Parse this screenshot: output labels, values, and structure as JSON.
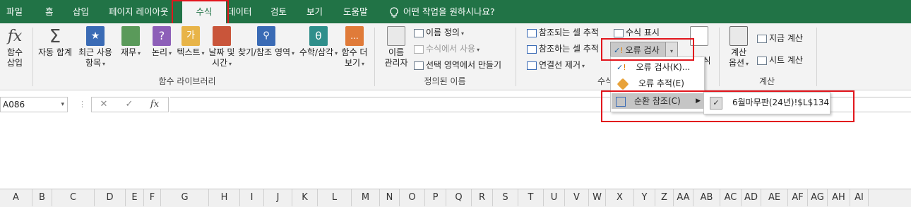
{
  "tabs": [
    {
      "label": "파일"
    },
    {
      "label": "홈"
    },
    {
      "label": "삽입"
    },
    {
      "label": "페이지 레이아웃"
    },
    {
      "label": "수식"
    },
    {
      "label": "데이터"
    },
    {
      "label": "검토"
    },
    {
      "label": "보기"
    },
    {
      "label": "도움말"
    }
  ],
  "tell_me": "어떤 작업을 원하시나요?",
  "function_library": {
    "group_label": "함수 라이브러리",
    "insert_function": {
      "line1": "함수",
      "line2": "삽입",
      "icon": "fx"
    },
    "autosum": {
      "line1": "자동 합계",
      "icon": "Σ"
    },
    "recent": {
      "line1": "최근 사용",
      "line2": "항목"
    },
    "financial": {
      "line1": "재무"
    },
    "logical": {
      "line1": "논리",
      "icon": "?"
    },
    "text": {
      "line1": "텍스트",
      "icon": "가"
    },
    "date_time": {
      "line1": "날짜 및",
      "line2": "시간"
    },
    "lookup": {
      "line1": "찾기/참조 영역"
    },
    "math": {
      "line1": "수학/삼각",
      "icon": "θ"
    },
    "more": {
      "line1": "함수 더",
      "line2": "보기",
      "icon": "..."
    }
  },
  "defined_names": {
    "group_label": "정의된 이름",
    "name_manager": {
      "line1": "이름",
      "line2": "관리자"
    },
    "define_name": "이름 정의",
    "use_in_formula": "수식에서 사용",
    "create_from_selection": "선택 영역에서 만들기"
  },
  "formula_auditing": {
    "group_label": "수식 분석",
    "trace_precedents": "참조되는 셀 추적",
    "trace_dependents": "참조하는 셀 추적",
    "remove_arrows": "연결선 제거",
    "show_formulas": "수식 표시",
    "error_checking": "오류 검사",
    "watch_window": "조사식"
  },
  "calculation": {
    "group_label": "계산",
    "options": {
      "line1": "계산",
      "line2": "옵션"
    },
    "calc_now": "지금 계산",
    "calc_sheet": "시트 계산"
  },
  "error_menu": {
    "items": [
      {
        "label": "오류 검사(K)..."
      },
      {
        "label": "오류 추적(E)"
      },
      {
        "label": "순환 참조(C)"
      }
    ]
  },
  "circular_submenu": {
    "item": "6월마무판(24년)!$L$134"
  },
  "formula_bar": {
    "name_box": "A086",
    "cancel_icon": "✕",
    "enter_icon": "✓",
    "fx_label": "fx"
  },
  "columns": [
    "A",
    "B",
    "C",
    "D",
    "E",
    "F",
    "G",
    "H",
    "I",
    "J",
    "K",
    "L",
    "M",
    "N",
    "O",
    "P",
    "Q",
    "R",
    "S",
    "T",
    "U",
    "V",
    "W",
    "X",
    "Y",
    "Z",
    "AA",
    "AB",
    "AC",
    "AD",
    "AE",
    "AF",
    "AG",
    "AH",
    "AI"
  ],
  "colors": {
    "accent": "#217346",
    "highlight": "#e2161d"
  }
}
